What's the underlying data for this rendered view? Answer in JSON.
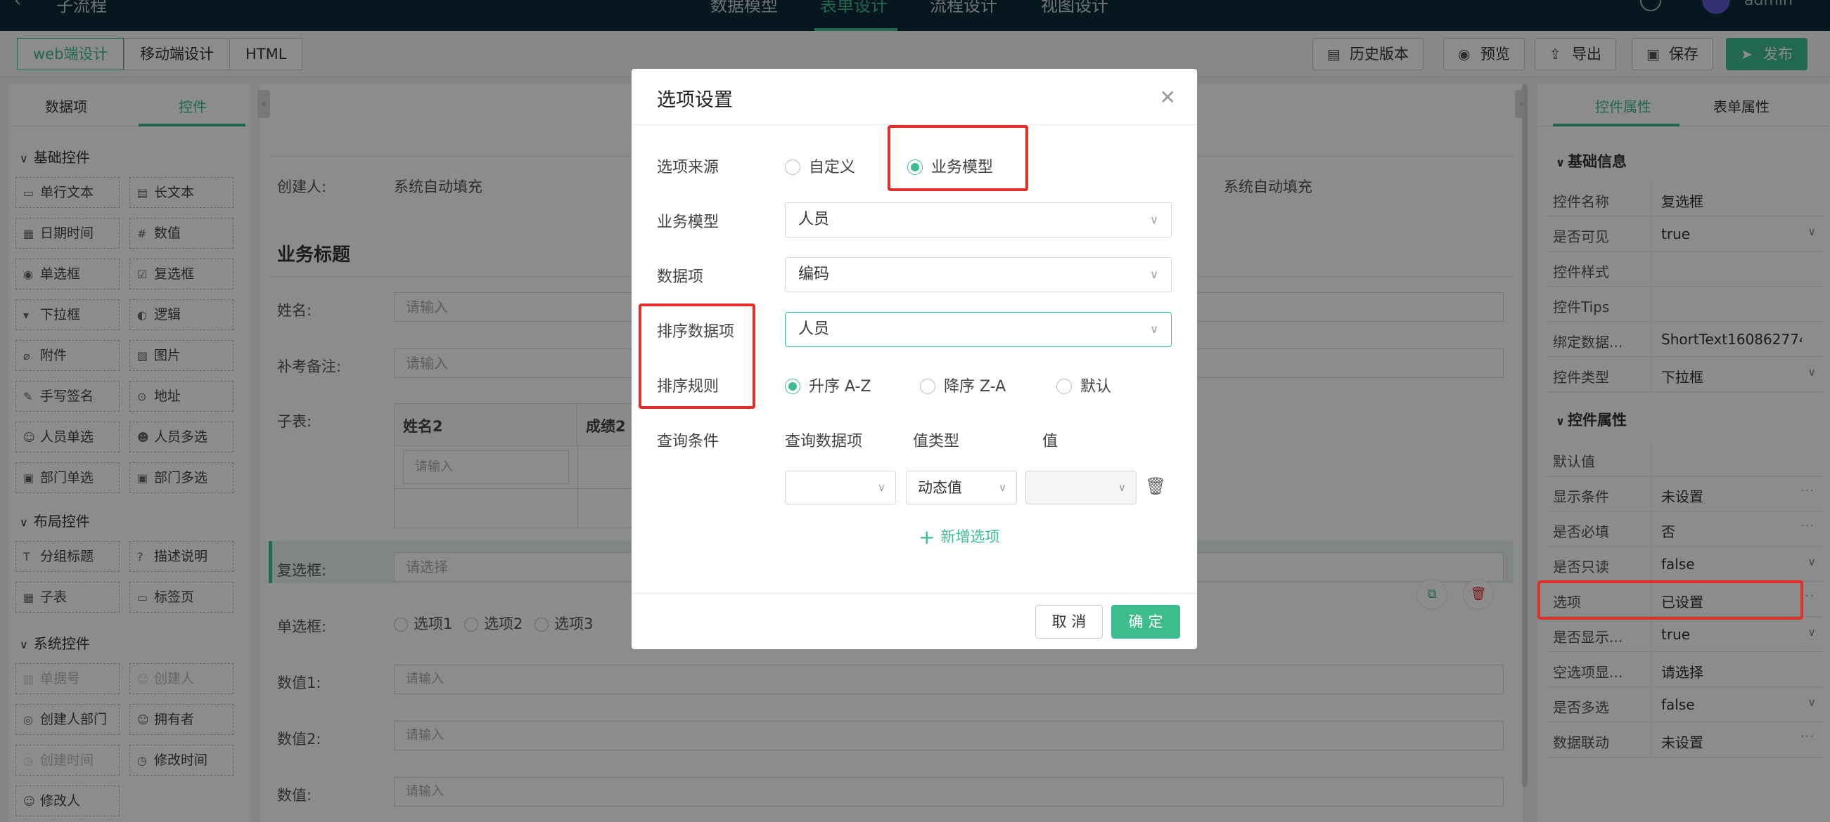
{
  "colors": {
    "accent": "#3dbd8e",
    "nav_bg": "#0e2a3a",
    "annotation": "#e0302a"
  },
  "topnav": {
    "back_icon": "‹",
    "app_title": "子流程",
    "tabs": [
      "数据模型",
      "表单设计",
      "流程设计",
      "视图设计"
    ],
    "active_tab": "表单设计",
    "username": "admin"
  },
  "toolbar": {
    "seg": [
      "web端设计",
      "移动端设计",
      "HTML"
    ],
    "history": "历史版本",
    "preview": "预览",
    "export": "导出",
    "save": "保存",
    "publish": "发布"
  },
  "leftpanel": {
    "tabs": [
      "数据项",
      "控件"
    ],
    "groups": {
      "basic": "基础控件",
      "layout": "布局控件",
      "system": "系统控件"
    },
    "basic": [
      "单行文本",
      "长文本",
      "日期时间",
      "数值",
      "单选框",
      "复选框",
      "下拉框",
      "逻辑",
      "附件",
      "图片",
      "手写签名",
      "地址",
      "人员单选",
      "人员多选",
      "部门单选",
      "部门多选"
    ],
    "layout": [
      "分组标题",
      "描述说明",
      "子表",
      "标签页"
    ],
    "system": [
      "单据号",
      "创建人",
      "创建人部门",
      "拥有者",
      "创建时间",
      "修改时间",
      "修改人"
    ]
  },
  "canvas": {
    "creator_label": "创建人:",
    "creator_value": "系统自动填充",
    "creator_value2": "系统自动填充",
    "section_title": "业务标题",
    "name_label": "姓名:",
    "input_placeholder": "请输入",
    "remark_label": "补考备注:",
    "subtable_label": "子表:",
    "subtable_cols": [
      "姓名2",
      "成绩2"
    ],
    "checkbox_label": "复选框:",
    "select_placeholder": "请选择",
    "radio_label": "单选框:",
    "radio_options": [
      "选项1",
      "选项2",
      "选项3"
    ],
    "num1_label": "数值1:",
    "num2_label": "数值2:",
    "num_label": "数值:"
  },
  "rightpanel": {
    "tabs": [
      "控件属性",
      "表单属性"
    ],
    "section_basic": "基础信息",
    "section_props": "控件属性",
    "basic_rows": [
      {
        "k": "控件名称",
        "v": "复选框"
      },
      {
        "k": "是否可见",
        "v": "true"
      },
      {
        "k": "控件样式",
        "v": ""
      },
      {
        "k": "控件Tips",
        "v": ""
      },
      {
        "k": "绑定数据...",
        "v": "ShortText160862774..."
      },
      {
        "k": "控件类型",
        "v": "下拉框"
      }
    ],
    "prop_rows": [
      {
        "k": "默认值",
        "v": ""
      },
      {
        "k": "显示条件",
        "v": "未设置"
      },
      {
        "k": "是否必填",
        "v": "否"
      },
      {
        "k": "是否只读",
        "v": "false"
      },
      {
        "k": "选项",
        "v": "已设置"
      },
      {
        "k": "是否显示...",
        "v": "true"
      },
      {
        "k": "空选项显...",
        "v": "请选择"
      },
      {
        "k": "是否多选",
        "v": "false"
      },
      {
        "k": "数据联动",
        "v": "未设置"
      }
    ]
  },
  "modal": {
    "title": "选项设置",
    "source_label": "选项来源",
    "source_options": [
      "自定义",
      "业务模型"
    ],
    "source_selected": "业务模型",
    "model_label": "业务模型",
    "model_value": "人员",
    "field_label": "数据项",
    "field_value": "编码",
    "sort_field_label": "排序数据项",
    "sort_field_value": "人员",
    "sort_rule_label": "排序规则",
    "sort_options": [
      "升序 A-Z",
      "降序 Z-A",
      "默认"
    ],
    "sort_selected": "升序 A-Z",
    "query_label": "查询条件",
    "query_cols": [
      "查询数据项",
      "值类型",
      "值"
    ],
    "value_type": "动态值",
    "add_option": "新增选项",
    "cancel": "取 消",
    "ok": "确 定"
  }
}
